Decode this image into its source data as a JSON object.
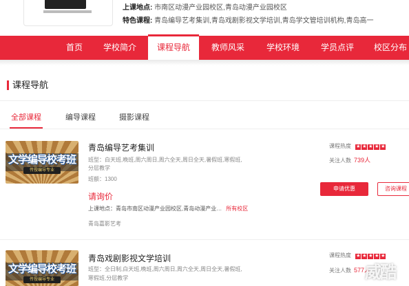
{
  "header": {
    "address_label": "上课地点:",
    "address_value": "市南区动漫产业园校区,青岛动漫产业园校区",
    "feature_label": "特色课程:",
    "feature_value": "青岛编导艺考集训,青岛戏剧影视文学培训,青岛学文管培训机构,青岛高一"
  },
  "nav": {
    "items": [
      {
        "label": "首页"
      },
      {
        "label": "学校简介"
      },
      {
        "label": "课程导航"
      },
      {
        "label": "教师风采"
      },
      {
        "label": "学校环境"
      },
      {
        "label": "学员点评"
      },
      {
        "label": "校区分布"
      }
    ],
    "active_index": 2
  },
  "section": {
    "title": "课程导航"
  },
  "tabs": [
    {
      "label": "全部课程"
    },
    {
      "label": "编导课程"
    },
    {
      "label": "摄影课程"
    }
  ],
  "courses": [
    {
      "thumb_title": "文学编导校考班",
      "thumb_sub": "传授编导专业",
      "title": "青岛编导艺考集训",
      "schedule_line1": "班型：白天班,晚班,周六周日,周六全天,周日全天,暑假班,寒假班,",
      "schedule_line2": "分层教学",
      "class_size": "班额：1300",
      "price": "请询价",
      "address_label": "上课地点：",
      "address_value": "青岛市南区动漫产业园校区,青岛动漫产业…",
      "all_campuses": "所有校区",
      "school": "青岛嘉影艺考",
      "rating_label": "课程热度",
      "follow_label": "关注人数",
      "follow_count": "739人",
      "apply_label": "申请优惠",
      "consult_label": "咨询课程"
    },
    {
      "thumb_title": "文学编导校考班",
      "thumb_sub": "传授编导专业",
      "title": "青岛戏剧影视文学培训",
      "schedule_line1": "班型：全日制,白天班,晚班,周六周日,周六全天,周日全天,暑假班,",
      "schedule_line2": "寒假班,分层教学",
      "rating_label": "课程热度",
      "follow_label": "关注人数",
      "follow_count": "577人"
    }
  ],
  "watermark": "威酷"
}
